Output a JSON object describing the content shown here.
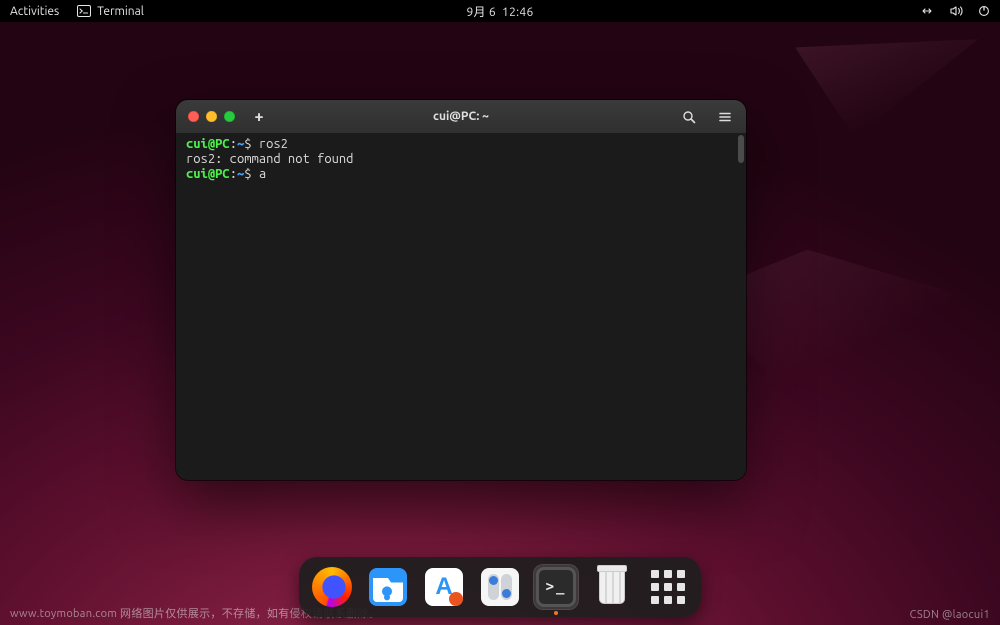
{
  "top_panel": {
    "activities": "Activities",
    "app_name": "Terminal",
    "datetime": "9月 6  12:46"
  },
  "terminal": {
    "title": "cui@PC: ~",
    "lines": [
      {
        "prompt_user": "cui@PC",
        "prompt_sep": ":",
        "prompt_path": "~",
        "prompt_dollar": "$ ",
        "command": "ros2"
      },
      {
        "plain": "ros2: command not found"
      },
      {
        "prompt_user": "cui@PC",
        "prompt_sep": ":",
        "prompt_path": "~",
        "prompt_dollar": "$ ",
        "command": "a"
      }
    ]
  },
  "dock": {
    "items": [
      {
        "name": "firefox",
        "active": false,
        "running": false
      },
      {
        "name": "files",
        "active": false,
        "running": false
      },
      {
        "name": "software-center",
        "active": false,
        "running": false
      },
      {
        "name": "settings",
        "active": false,
        "running": false
      },
      {
        "name": "terminal",
        "active": true,
        "running": true
      },
      {
        "name": "trash",
        "active": false,
        "running": false
      },
      {
        "name": "show-applications",
        "active": false,
        "running": false
      }
    ]
  },
  "watermark": {
    "left": "www.toymoban.com 网络图片仅供展示，不存储，如有侵权请联系删除。",
    "right": "CSDN @laocui1"
  }
}
